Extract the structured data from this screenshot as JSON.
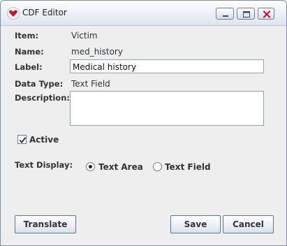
{
  "window": {
    "title": "CDF Editor",
    "icon": "red-heart-app-icon",
    "controls": [
      "minimize-icon",
      "maximize-icon",
      "close-icon"
    ]
  },
  "form": {
    "item": {
      "label": "Item:",
      "value": "Victim"
    },
    "name": {
      "label": "Name:",
      "value": "med_history"
    },
    "label_field": {
      "label": "Label:",
      "value": "Medical history"
    },
    "data_type": {
      "label": "Data Type:",
      "value": "Text Field"
    },
    "description": {
      "label": "Description:",
      "value": ""
    },
    "active": {
      "label": "Active",
      "checked": true
    },
    "text_display": {
      "label": "Text Display:",
      "options": [
        "Text Area",
        "Text Field"
      ],
      "selected": "Text Area"
    }
  },
  "buttons": {
    "translate": "Translate",
    "save": "Save",
    "cancel": "Cancel"
  },
  "colors": {
    "window_background": "#eeeeee",
    "titlebar": "#e6ecf3",
    "close_button": "#c8102e",
    "border": "#7a8ca6"
  }
}
